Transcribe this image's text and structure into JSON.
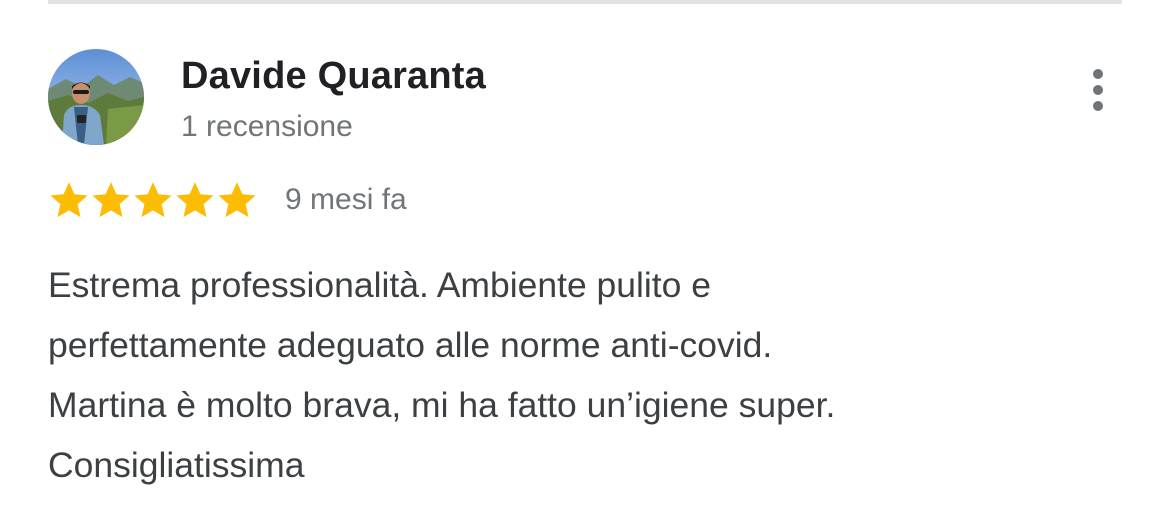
{
  "review": {
    "reviewer_name": "Davide Quaranta",
    "review_count": "1 recensione",
    "rating": 5,
    "max_rating": 5,
    "date": "9 mesi fa",
    "text": "Estrema professionalità. Ambiente pulito e\nperfettamente adeguato alle norme anti-covid.\nMartina è molto brava, mi ha fatto un’igiene super.\nConsigliatissima",
    "avatar_icon": "user-avatar-photo",
    "more_icon": "more-vert-icon"
  },
  "colors": {
    "star": "#fbbc04",
    "secondary_text": "#70757a",
    "body_text": "#3c4043",
    "name_text": "#202124",
    "divider": "#e3e3e3"
  }
}
